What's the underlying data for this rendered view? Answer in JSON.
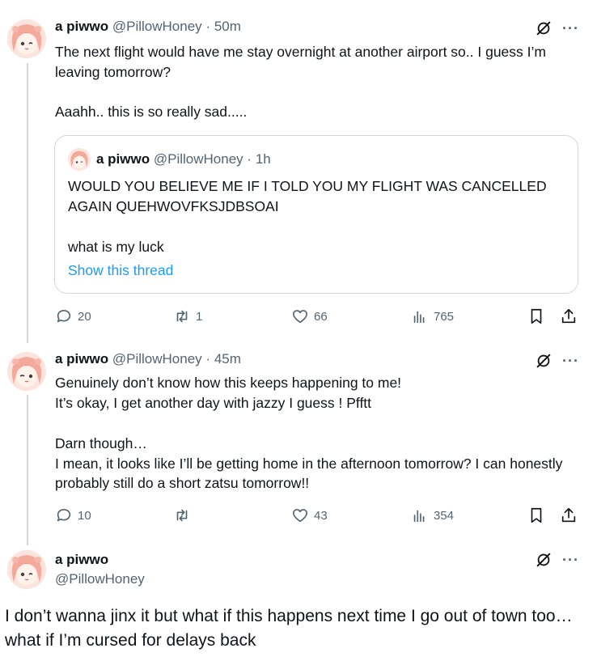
{
  "colors": {
    "text": "#0f1419",
    "muted": "#536471",
    "link": "#1d9bf0",
    "border": "#cfd9de"
  },
  "icons": {
    "grok": "grok-slash-circle-icon",
    "more": "more-horizontal-icon",
    "reply": "reply-bubble-icon",
    "retweet": "retweet-icon",
    "like": "heart-icon",
    "views": "views-bar-chart-icon",
    "bookmark": "bookmark-icon",
    "share": "share-upload-icon"
  },
  "tweets": [
    {
      "name": "a piwwo",
      "handle": "@PillowHoney",
      "dot": "·",
      "time": "50m",
      "more": "···",
      "text": "The next flight would have me stay overnight at another airport so.. I guess I’m leaving tomorrow?",
      "text2": "Aaahh.. this is so really sad.....",
      "quote": {
        "name": "a piwwo",
        "handle": "@PillowHoney",
        "dot": "·",
        "time": "1h",
        "text": "WOULD YOU BELIEVE ME IF I TOLD YOU MY FLIGHT WAS CANCELLED AGAIN QUEHWOVFKSJDBSOAI",
        "text2": "what is my luck",
        "link": "Show this thread"
      },
      "replies": "20",
      "retweets": "1",
      "likes": "66",
      "views": "765"
    },
    {
      "name": "a piwwo",
      "handle": "@PillowHoney",
      "dot": "·",
      "time": "45m",
      "more": "···",
      "text": "Genuinely don’t know how this keeps happening to me!\nIt’s okay, I get another day with jazzy I guess ! Pfftt",
      "text2": "Darn though…\nI mean, it looks like I’ll be getting home in the afternoon tomorrow? I can honestly probably still do a short zatsu tomorrow!!",
      "replies": "10",
      "retweets": "",
      "likes": "43",
      "views": "354"
    },
    {
      "name": "a piwwo",
      "handle": "@PillowHoney",
      "more": "···",
      "text": "I don’t wanna jinx it but what if this happens next time I go out of town too… what if I’m cursed for delays back"
    }
  ]
}
